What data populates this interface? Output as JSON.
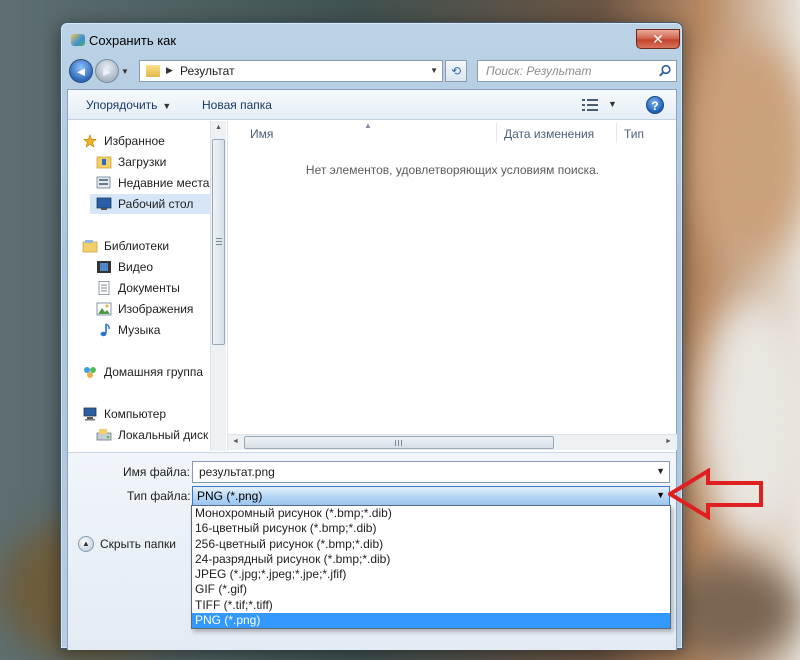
{
  "window": {
    "title": "Сохранить как",
    "close_glyph": "✕"
  },
  "address_bar": {
    "path": "Результат",
    "search_placeholder": "Поиск: Результат"
  },
  "toolbar": {
    "organize_label": "Упорядочить",
    "new_folder_label": "Новая папка",
    "help_glyph": "?"
  },
  "navigation": {
    "items": [
      {
        "label": "Избранное",
        "icon": "star-icon"
      },
      {
        "label": "Загрузки",
        "icon": "downloads-folder-icon"
      },
      {
        "label": "Недавние места",
        "icon": "recent-places-icon"
      },
      {
        "label": "Рабочий стол",
        "icon": "desktop-icon",
        "selected": true
      },
      {
        "label": "Библиотеки",
        "icon": "libraries-icon"
      },
      {
        "label": "Видео",
        "icon": "video-icon"
      },
      {
        "label": "Документы",
        "icon": "documents-icon"
      },
      {
        "label": "Изображения",
        "icon": "pictures-icon"
      },
      {
        "label": "Музыка",
        "icon": "music-icon"
      },
      {
        "label": "Домашняя группа",
        "icon": "homegroup-icon"
      },
      {
        "label": "Компьютер",
        "icon": "computer-icon"
      },
      {
        "label": "Локальный диск",
        "icon": "local-disk-icon"
      }
    ]
  },
  "file_list": {
    "columns": [
      "Имя",
      "Дата изменения",
      "Тип"
    ],
    "empty_message": "Нет элементов, удовлетворяющих условиям поиска."
  },
  "form": {
    "filename_label": "Имя файла:",
    "filename_value": "результат.png",
    "filetype_label": "Тип файла:",
    "filetype_value": "PNG (*.png)",
    "hide_folders_label": "Скрыть папки"
  },
  "filetype_options": [
    "Монохромный рисунок (*.bmp;*.dib)",
    "16-цветный рисунок (*.bmp;*.dib)",
    "256-цветный рисунок (*.bmp;*.dib)",
    "24-разрядный рисунок (*.bmp;*.dib)",
    "JPEG (*.jpg;*.jpeg;*.jpe;*.jfif)",
    "GIF (*.gif)",
    "TIFF (*.tif;*.tiff)",
    "PNG (*.png)"
  ],
  "selected_option_index": 7,
  "colors": {
    "selection_blue": "#3399ff",
    "annotation_arrow": "#e02020"
  }
}
